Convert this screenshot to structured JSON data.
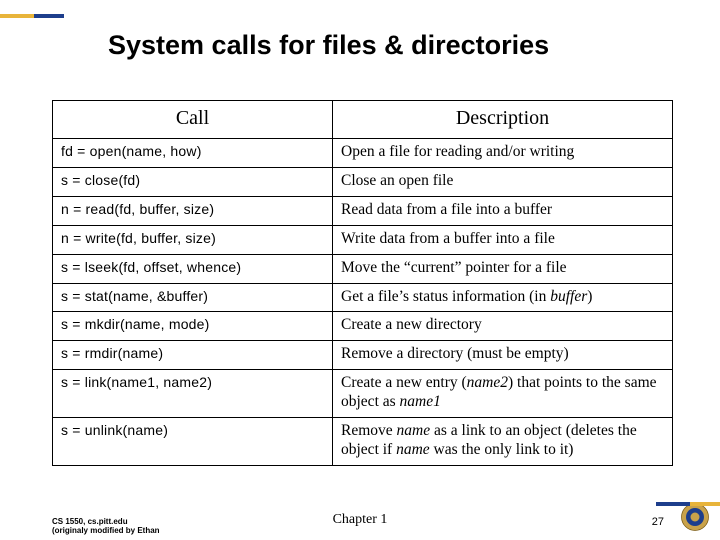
{
  "title": "System calls for files & directories",
  "headers": {
    "c1": "Call",
    "c2": "Description"
  },
  "rows": [
    {
      "call": "fd = open(name, how)",
      "desc": "Open a file for reading and/or writing"
    },
    {
      "call": "s = close(fd)",
      "desc": "Close an open file"
    },
    {
      "call": "n = read(fd, buffer, size)",
      "desc": "Read data from a file into a buffer"
    },
    {
      "call": "n = write(fd, buffer, size)",
      "desc": "Write data from a buffer into a file"
    },
    {
      "call": "s = lseek(fd, offset, whence)",
      "desc": "Move the “current” pointer for a file"
    },
    {
      "call": "s = stat(name, &buffer)",
      "desc": "Get a file’s status information (in <i>buffer</i>)"
    },
    {
      "call": "s = mkdir(name, mode)",
      "desc": "Create a new directory"
    },
    {
      "call": "s = rmdir(name)",
      "desc": "Remove a directory (must be empty)"
    },
    {
      "call": "s = link(name1, name2)",
      "desc": "Create a new entry (<i>name2</i>) that points to the same object as <i>name1</i>"
    },
    {
      "call": "s = unlink(name)",
      "desc": "Remove <i>name</i> as a link to an object (deletes the object if <i>name</i> was the only link to it)"
    }
  ],
  "footer": {
    "left_line1": "CS 1550, cs.pitt.edu",
    "left_line2": "(originaly modified by Ethan",
    "center": "Chapter 1",
    "page": "27"
  }
}
